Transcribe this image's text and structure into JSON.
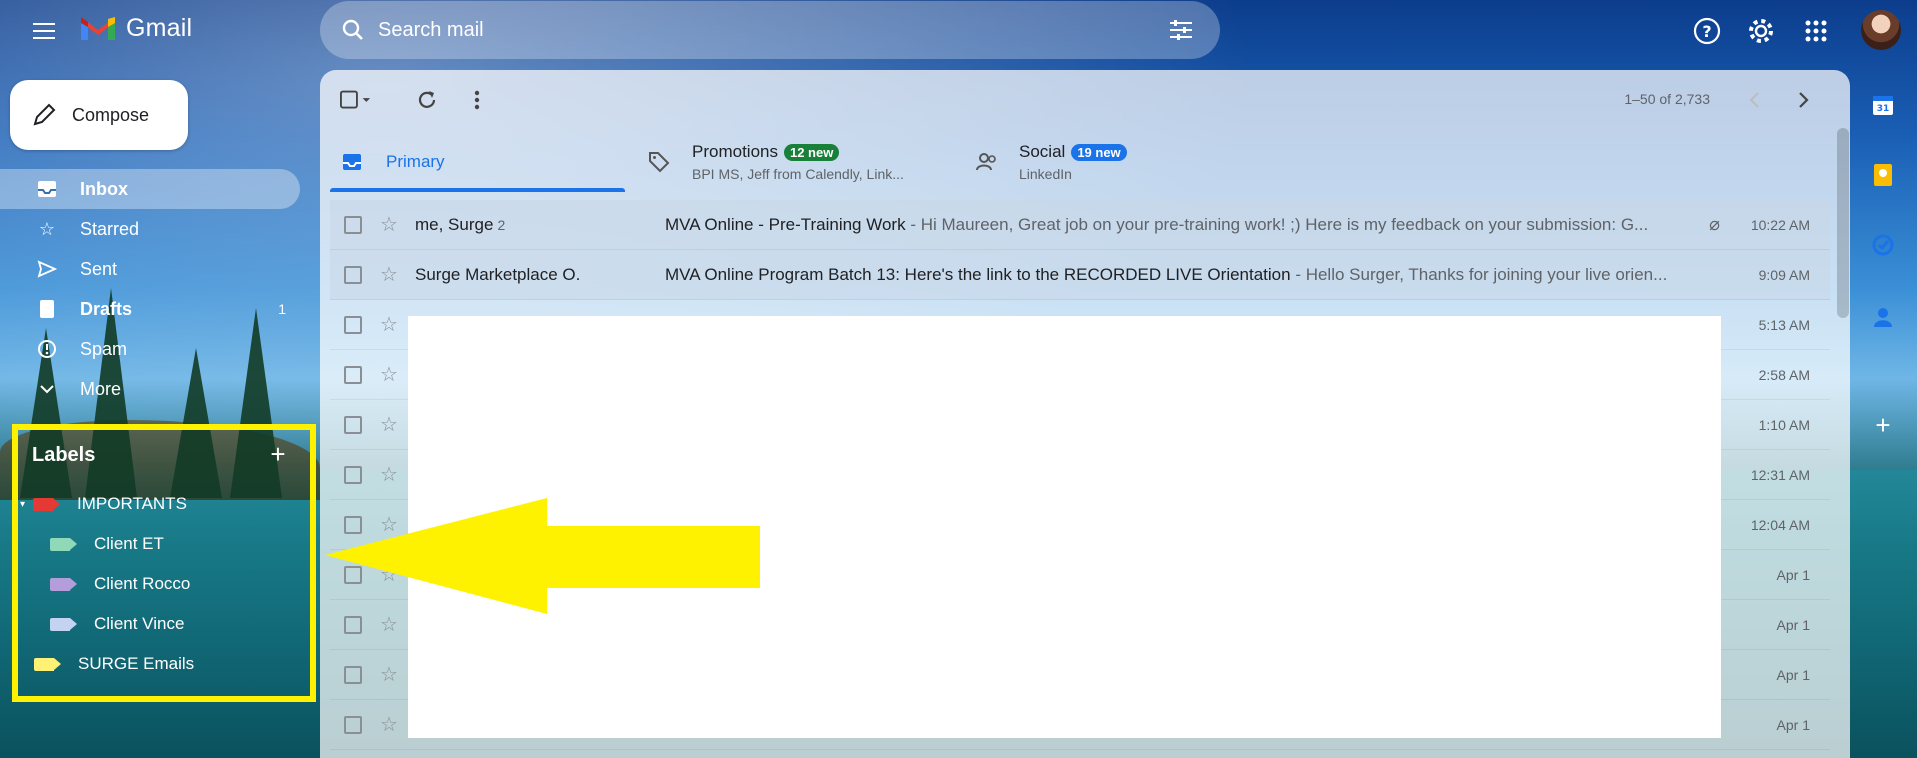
{
  "app": {
    "name": "Gmail"
  },
  "search": {
    "placeholder": "Search mail"
  },
  "compose": {
    "label": "Compose"
  },
  "nav": [
    {
      "label": "Inbox",
      "count": "",
      "icon": "inbox-icon",
      "active": true
    },
    {
      "label": "Starred",
      "count": "",
      "icon": "star-icon",
      "active": false
    },
    {
      "label": "Sent",
      "count": "",
      "icon": "send-icon",
      "active": false
    },
    {
      "label": "Drafts",
      "count": "1",
      "icon": "draft-icon",
      "active": false
    },
    {
      "label": "Spam",
      "count": "",
      "icon": "spam-icon",
      "active": false
    },
    {
      "label": "More",
      "count": "",
      "icon": "chevron-down-icon",
      "active": false
    }
  ],
  "labels": {
    "title": "Labels",
    "items": [
      {
        "name": "IMPORTANTS",
        "color": "#e53935"
      },
      {
        "name": "Client ET",
        "color": "#8fd8b8"
      },
      {
        "name": "Client Rocco",
        "color": "#b39ddb"
      },
      {
        "name": "Client Vince",
        "color": "#c5d3f2"
      },
      {
        "name": "SURGE Emails",
        "color": "#fff176"
      }
    ]
  },
  "toolbar": {
    "pager": "1–50 of 2,733"
  },
  "tabs": [
    {
      "title": "Primary",
      "sub": "",
      "badge": "",
      "badge_color": ""
    },
    {
      "title": "Promotions",
      "sub": "BPI MS, Jeff from Calendly, Link...",
      "badge": "12 new",
      "badge_color": "#188038"
    },
    {
      "title": "Social",
      "sub": "LinkedIn",
      "badge": "19 new",
      "badge_color": "#1a73e8"
    }
  ],
  "emails": [
    {
      "sender": "me, Surge",
      "count": "2",
      "subject": "MVA Online - Pre-Training Work",
      "snippet": " - Hi Maureen, Great job on your pre-training work! ;) Here is my feedback on your submission: G...",
      "time": "10:22 AM",
      "attachment": true
    },
    {
      "sender": "Surge Marketplace O.",
      "count": "",
      "subject": "MVA Online Program Batch 13: Here's the link to the RECORDED LIVE Orientation",
      "snippet": " - Hello Surger, Thanks for joining your live orien...",
      "time": "9:09 AM",
      "attachment": false
    },
    {
      "sender": "",
      "count": "",
      "subject": "",
      "snippet": "",
      "time": "5:13 AM",
      "attachment": false
    },
    {
      "sender": "",
      "count": "",
      "subject": "",
      "snippet": "",
      "time": "2:58 AM",
      "attachment": false
    },
    {
      "sender": "",
      "count": "",
      "subject": "",
      "snippet": "",
      "time": "1:10 AM",
      "attachment": false
    },
    {
      "sender": "",
      "count": "",
      "subject": "",
      "snippet": "",
      "time": "12:31 AM",
      "attachment": false
    },
    {
      "sender": "",
      "count": "",
      "subject": "",
      "snippet": "",
      "time": "12:04 AM",
      "attachment": false
    },
    {
      "sender": "",
      "count": "",
      "subject": "",
      "snippet": "",
      "time": "Apr 1",
      "attachment": false
    },
    {
      "sender": "",
      "count": "",
      "subject": "",
      "snippet": "",
      "time": "Apr 1",
      "attachment": false
    },
    {
      "sender": "",
      "count": "",
      "subject": "",
      "snippet": "",
      "time": "Apr 1",
      "attachment": false
    },
    {
      "sender": "",
      "count": "",
      "subject": "",
      "snippet": "",
      "time": "Apr 1",
      "attachment": false
    }
  ],
  "colors": {
    "accent": "#1a73e8",
    "highlight": "#fff200"
  }
}
